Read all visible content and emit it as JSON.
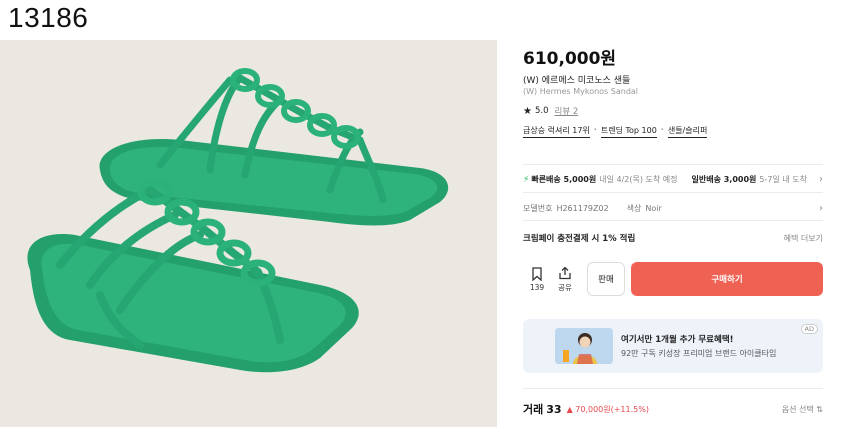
{
  "sku": "13186",
  "product": {
    "price": "610,000원",
    "name_ko": "(W) 에르메스 미코노스 샌들",
    "name_en": "(W) Hermes Mykonos Sandals",
    "rating": "5.0",
    "review_link": "리뷰 2",
    "tags": [
      "급상승 럭셔리 17위",
      "트렌딩 Top 100",
      "샌들/슬리퍼"
    ],
    "tag_separator": "·"
  },
  "shipping": {
    "fast_label": "빠른배송 5,000원",
    "fast_eta": "내일 4/2(목) 도착 예정",
    "normal_label": "일반배송 3,000원",
    "normal_eta": "5-7일 내 도착"
  },
  "model": {
    "model_label": "모델번호",
    "model_value": "H261179Z02",
    "color_label": "색상",
    "color_value": "Noir"
  },
  "payment": {
    "text": "크림페이 충전결제 시 1% 적립",
    "more": "혜택 더보기"
  },
  "actions": {
    "bookmark_count": "139",
    "share_label": "공유",
    "sell_label": "판매",
    "buy_label": "구매하기"
  },
  "ad": {
    "title": "여기서만 1개월 추가 무료혜택!",
    "subtitle": "92만 구독 키성장 프리미엄 브랜드 아이클타임",
    "badge": "AD"
  },
  "trade": {
    "label": "거래",
    "count": "33",
    "delta": "▲ 70,000원(+11.5%)",
    "option": "옵션 선택 ⇅"
  },
  "colors": {
    "buy_button": "#ef6253",
    "sandal": "#2fb37c",
    "background_photo": "#ebe8e2",
    "delta_red": "#e5484d"
  }
}
